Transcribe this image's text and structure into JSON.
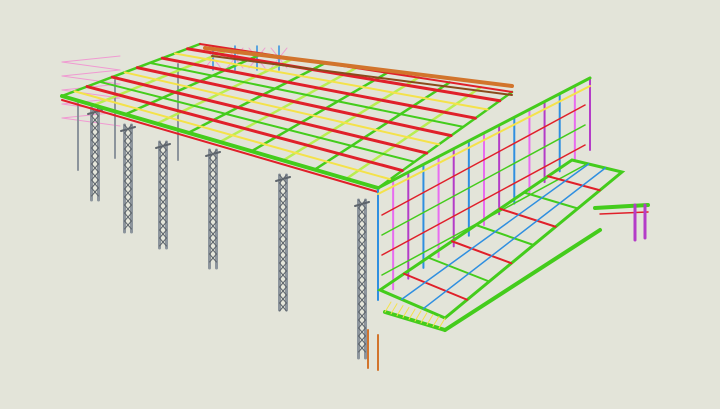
{
  "scene": {
    "subject": "steel-frame-building-3d-model",
    "colors": {
      "background": "#e3e4d9",
      "column_grey": "#8c949c",
      "column_lattice": "#5e656c",
      "rafter_red": "#e0202a",
      "purlin_green": "#44cc1c",
      "purlin_yellow": "#f4e24a",
      "purlin_lightgreen": "#b9ee52",
      "brace_pink": "#e86cf0",
      "brace_magenta": "#b43cc8",
      "upright_blue": "#2f8fe0",
      "timber_orange": "#d2742c",
      "timber_brown": "#8a4a1c",
      "plan_bracing": "#f09ad2"
    }
  }
}
